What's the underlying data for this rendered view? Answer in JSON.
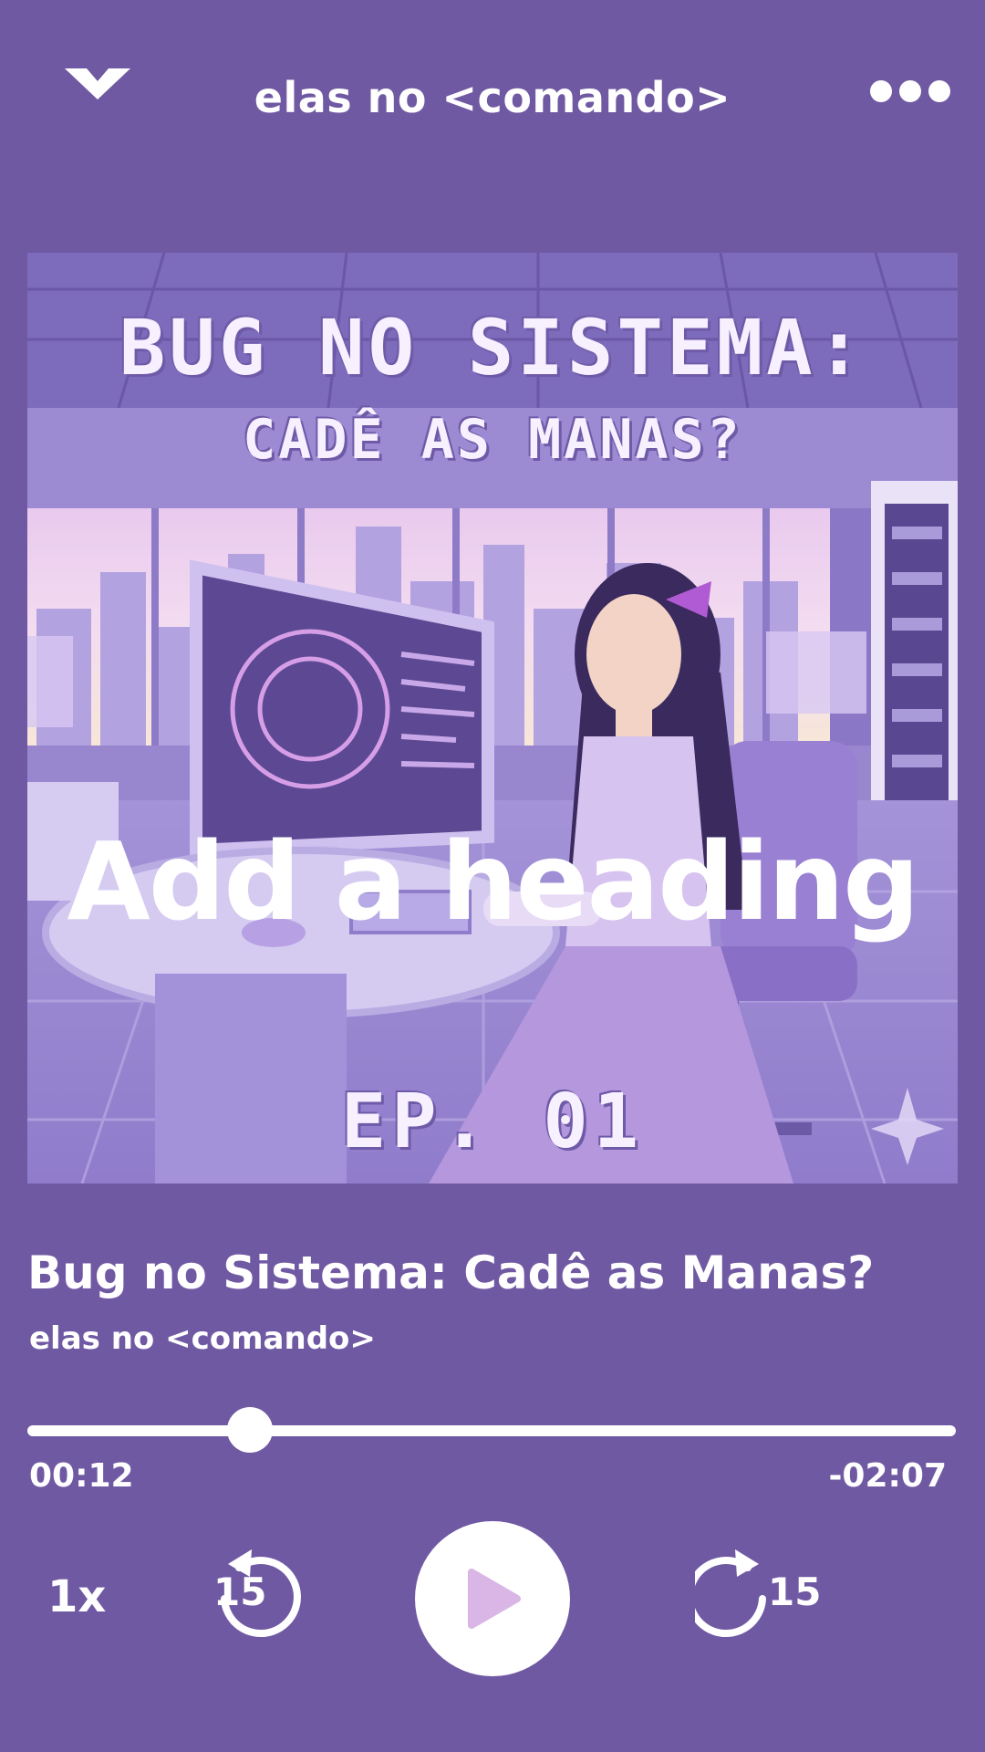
{
  "header": {
    "title": "elas no <comando>",
    "collapse_icon": "chevron-down-icon",
    "more_icon": "more-options-icon"
  },
  "cover": {
    "title_line_1": "BUG NO SISTEMA:",
    "title_line_2": "CADÊ AS MANAS?",
    "heading": "Add a heading",
    "episode": "EP. 01"
  },
  "episode": {
    "title": "Bug no Sistema: Cadê as Manas?",
    "show": "elas no <comando>"
  },
  "player": {
    "elapsed": "00:12",
    "remaining": "-02:07",
    "progress_fraction": 0.24,
    "speed": "1x",
    "rewind_seconds": "15",
    "forward_seconds": "15",
    "play_icon": "play-icon"
  },
  "colors": {
    "background": "#7059a3",
    "play_icon": "#d9b6e6",
    "text": "#ffffff"
  }
}
